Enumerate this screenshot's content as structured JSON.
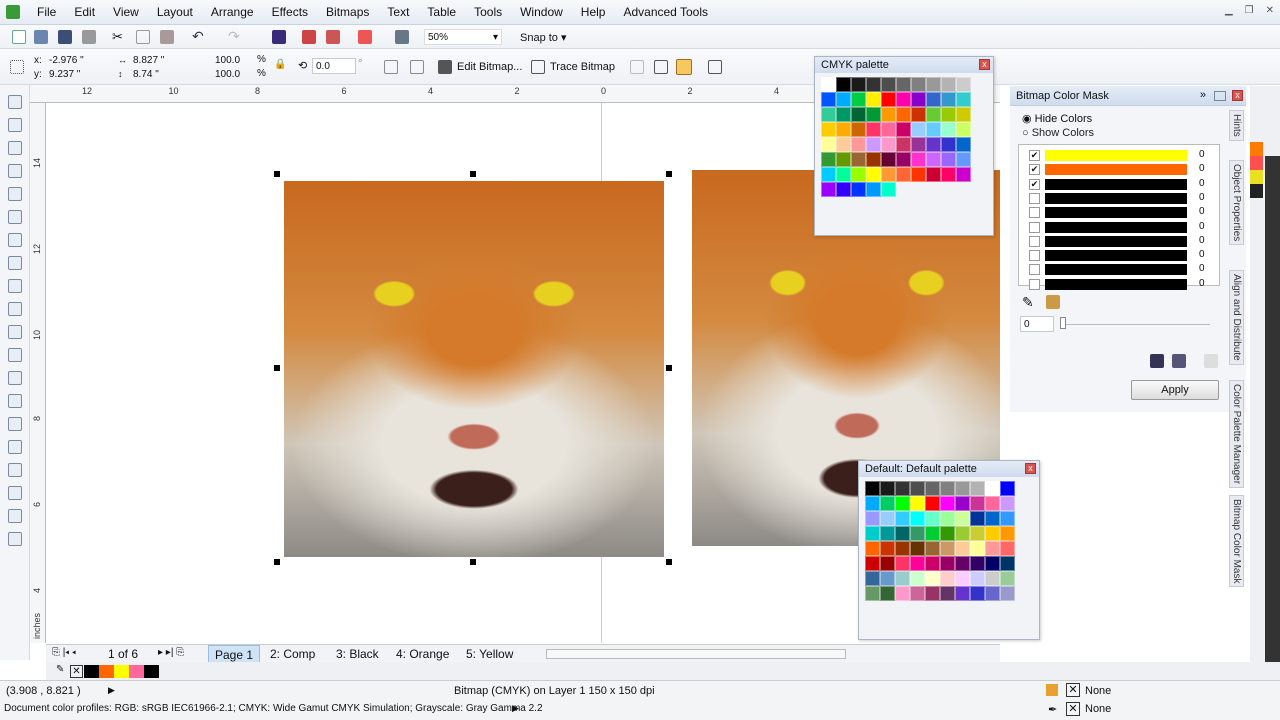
{
  "menu": [
    "File",
    "Edit",
    "View",
    "Layout",
    "Arrange",
    "Effects",
    "Bitmaps",
    "Text",
    "Table",
    "Tools",
    "Window",
    "Help",
    "Advanced Tools"
  ],
  "toolbar": {
    "zoom": "50%",
    "snap": "Snap to"
  },
  "props": {
    "x": "-2.976 \"",
    "y": "9.237 \"",
    "w": "8.827 \"",
    "h": "8.74 \"",
    "sx": "100.0",
    "sy": "100.0",
    "pct": "%",
    "angle": "0.0",
    "deg": "°",
    "edit_bitmap": "Edit Bitmap...",
    "trace_bitmap": "Trace Bitmap"
  },
  "ruler": {
    "h": [
      "12",
      "10",
      "8",
      "6",
      "4",
      "2",
      "0",
      "2",
      "4"
    ],
    "v": [
      "14",
      "12",
      "10",
      "8",
      "6",
      "4"
    ],
    "unit": "inches"
  },
  "cmyk_palette": {
    "title": "CMYK palette",
    "colors": [
      "#ffffff",
      "#000000",
      "#1a1a1a",
      "#333333",
      "#4d4d4d",
      "#666666",
      "#808080",
      "#999999",
      "#b3b3b3",
      "#cccccc",
      "#0055ff",
      "#00aaff",
      "#00cc44",
      "#ffee00",
      "#ff0000",
      "#ff00aa",
      "#8800cc",
      "#3366cc",
      "#3399cc",
      "#33cccc",
      "#33cc99",
      "#009966",
      "#006633",
      "#009933",
      "#ff9900",
      "#ff6600",
      "#cc3300",
      "#66cc33",
      "#99cc00",
      "#cccc00",
      "#ffcc00",
      "#ffaa00",
      "#cc6600",
      "#ff3366",
      "#ff6699",
      "#cc0066",
      "#99ccff",
      "#66ccff",
      "#99ffcc",
      "#ccff66",
      "#ffff99",
      "#ffcc99",
      "#ff9999",
      "#cc99ff",
      "#ff99cc",
      "#cc3366",
      "#993399",
      "#6633cc",
      "#3333cc",
      "#0066cc",
      "#339933",
      "#669900",
      "#996633",
      "#993300",
      "#660033",
      "#990066",
      "#ff33cc",
      "#cc66ff",
      "#9966ff",
      "#6699ff",
      "#00ccff",
      "#00ff99",
      "#99ff00",
      "#ffff00",
      "#ff9933",
      "#ff6633",
      "#ff3300",
      "#cc0033",
      "#ff0066",
      "#cc00cc",
      "#9900ff",
      "#3300ff",
      "#0033ff",
      "#0099ff",
      "#00ffcc"
    ]
  },
  "default_palette": {
    "title": "Default: Default palette",
    "colors": [
      "#000000",
      "#1a1a1a",
      "#333333",
      "#4d4d4d",
      "#666666",
      "#808080",
      "#999999",
      "#b3b3b3",
      "#ffffff",
      "#0000ff",
      "#00aaff",
      "#00cc66",
      "#00ff00",
      "#ffff00",
      "#ff0000",
      "#ff00ff",
      "#9900cc",
      "#cc3399",
      "#ff6699",
      "#cc99ff",
      "#9999ff",
      "#99ccff",
      "#33ccff",
      "#00ffff",
      "#66ffcc",
      "#99ff99",
      "#ccff99",
      "#003399",
      "#0066cc",
      "#3399ff",
      "#00cccc",
      "#009999",
      "#006666",
      "#339966",
      "#00cc33",
      "#339900",
      "#99cc33",
      "#cccc33",
      "#ffcc00",
      "#ff9900",
      "#ff6600",
      "#cc3300",
      "#993300",
      "#663300",
      "#996633",
      "#cc9966",
      "#ffcc99",
      "#ffff99",
      "#ff9999",
      "#ff6666",
      "#cc0000",
      "#990000",
      "#ff3366",
      "#ff0099",
      "#cc0066",
      "#990066",
      "#660066",
      "#330066",
      "#000066",
      "#003366",
      "#336699",
      "#6699cc",
      "#99cccc",
      "#ccffcc",
      "#ffffcc",
      "#ffcccc",
      "#ffccff",
      "#ccccff",
      "#cccccc",
      "#99cc99",
      "#669966",
      "#336633",
      "#ff99cc",
      "#cc6699",
      "#993366",
      "#663366",
      "#6633cc",
      "#3333cc",
      "#6666cc",
      "#9999cc"
    ]
  },
  "bcm": {
    "title": "Bitmap Color Mask",
    "hide": "Hide Colors",
    "show": "Show Colors",
    "rows": [
      {
        "color": "#ffff00",
        "checked": true,
        "value": "0"
      },
      {
        "color": "#ff6600",
        "checked": true,
        "value": "0"
      },
      {
        "color": "#000000",
        "checked": true,
        "value": "0"
      },
      {
        "color": "#000000",
        "checked": false,
        "value": "0"
      },
      {
        "color": "#000000",
        "checked": false,
        "value": "0"
      },
      {
        "color": "#000000",
        "checked": false,
        "value": "0"
      },
      {
        "color": "#000000",
        "checked": false,
        "value": "0"
      },
      {
        "color": "#000000",
        "checked": false,
        "value": "0"
      },
      {
        "color": "#000000",
        "checked": false,
        "value": "0"
      },
      {
        "color": "#000000",
        "checked": false,
        "value": "0"
      }
    ],
    "tolerance": "0",
    "apply": "Apply"
  },
  "docker_tabs": [
    "Hints",
    "Object Properties",
    "Align and Distribute",
    "Color Palette Manager",
    "Bitmap Color Mask"
  ],
  "pages": {
    "counter": "1 of 6",
    "tabs": [
      "Page 1",
      "2: Comp",
      "3: Black",
      "4: Orange",
      "5: Yellow"
    ]
  },
  "doc_palette": [
    "#000000",
    "#ff6600",
    "#ffff00",
    "#ff6699",
    "#000000"
  ],
  "status": {
    "coords": "(3.908 , 8.821 )",
    "info": "Bitmap (CMYK) on Layer 1 150 x 150 dpi",
    "fill": "None",
    "outline": "None",
    "profiles": "Document color profiles: RGB: sRGB IEC61966-2.1; CMYK: Wide Gamut CMYK Simulation; Grayscale: Gray Gamma 2.2"
  }
}
